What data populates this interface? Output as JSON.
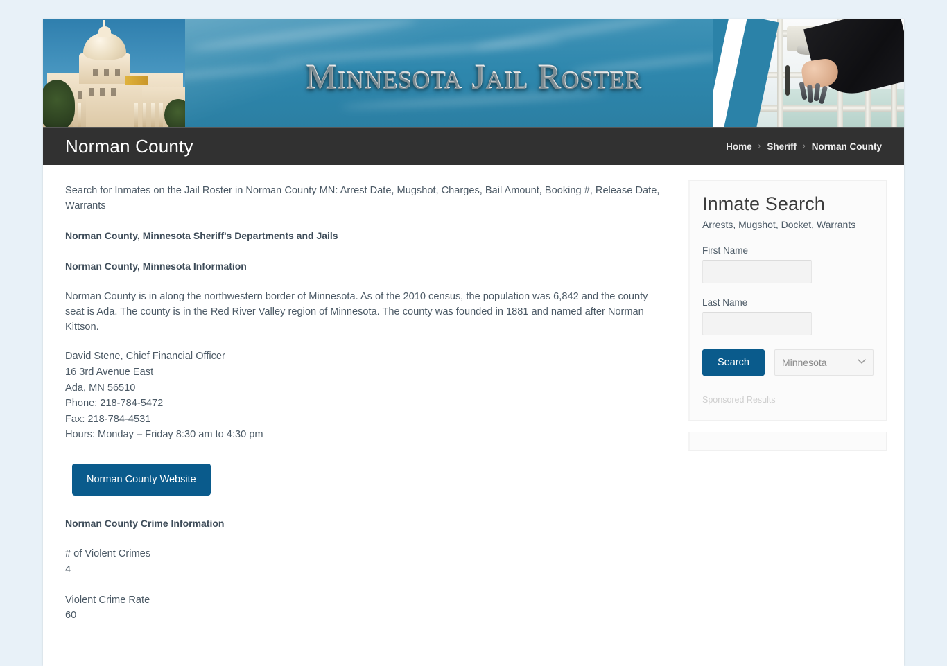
{
  "banner": {
    "title": "Minnesota Jail Roster",
    "left_image": "minnesota-state-capitol-photo",
    "right_image": "jail-door-keys-photo"
  },
  "titlebar": {
    "page_title": "Norman County",
    "breadcrumb": [
      {
        "label": "Home",
        "current": false
      },
      {
        "label": "Sheriff",
        "current": false
      },
      {
        "label": "Norman County",
        "current": true
      }
    ],
    "separator": "›"
  },
  "main": {
    "lead": "Search for Inmates on the Jail Roster in Norman County MN: Arrest Date, Mugshot, Charges, Bail Amount, Booking #, Release Date, Warrants",
    "heading_departments": "Norman County, Minnesota Sheriff's Departments and Jails",
    "heading_information": "Norman County, Minnesota Information",
    "description": "Norman County is in along the northwestern border of Minnesota. As of the 2010 census, the population was 6,842 and the county seat is Ada. The county is in the Red River Valley region of Minnesota. The county was founded in 1881 and named after Norman Kittson.",
    "contact": {
      "officer": "David Stene, Chief Financial Officer",
      "street": "16 3rd Avenue East",
      "city_state_zip": "Ada, MN 56510",
      "phone": "Phone: 218-784-5472",
      "fax": "Fax: 218-784-4531",
      "hours": "Hours: Monday – Friday 8:30 am to 4:30 pm"
    },
    "website_button": "Norman County Website",
    "crime_heading": "Norman County Crime Information",
    "stats": [
      {
        "label": "# of Violent Crimes",
        "value": "4"
      },
      {
        "label": "Violent Crime Rate",
        "value": "60"
      }
    ]
  },
  "sidebar": {
    "search_widget": {
      "title": "Inmate Search",
      "subtitle": "Arrests, Mugshot, Docket, Warrants",
      "first_name_label": "First Name",
      "first_name_value": "",
      "first_name_placeholder": "",
      "last_name_label": "Last Name",
      "last_name_value": "",
      "last_name_placeholder": "",
      "search_button": "Search",
      "state_selected": "Minnesota",
      "chevron": "⌄",
      "sponsored": "Sponsored Results"
    }
  },
  "colors": {
    "page_background": "#e8f1f8",
    "banner_blue": "#2e87ad",
    "titlebar_dark": "#313131",
    "accent_button": "#0a5b8c",
    "body_text": "#4c5a66"
  }
}
